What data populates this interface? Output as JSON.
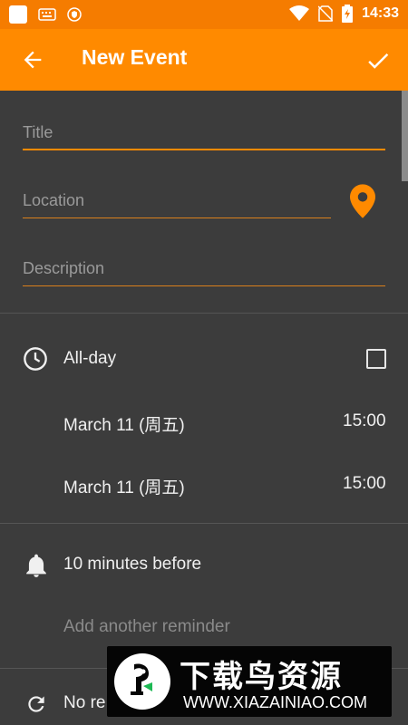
{
  "status_bar": {
    "time": "14:33",
    "icons": [
      "app-square-icon",
      "keyboard-icon",
      "shield-icon",
      "wifi-icon",
      "no-sim-icon",
      "battery-charging-icon"
    ]
  },
  "app_bar": {
    "title": "New Event",
    "back_icon": "arrow-left-icon",
    "save_icon": "check-icon"
  },
  "form": {
    "title_placeholder": "Title",
    "location_placeholder": "Location",
    "description_placeholder": "Description"
  },
  "all_day": {
    "label": "All-day",
    "checked": false
  },
  "start": {
    "date": "March 11 (周五)",
    "time": "15:00"
  },
  "end": {
    "date": "March 11 (周五)",
    "time": "15:00"
  },
  "reminders": {
    "first": "10 minutes before",
    "add": "Add another reminder"
  },
  "repeat": {
    "label_visible": "No re"
  },
  "watermark": {
    "chinese": "下载鸟资源",
    "url": "WWW.XIAZAINIAO.COM"
  },
  "colors": {
    "accent": "#ff8a00",
    "status_bar": "#f57c00",
    "background": "#3c3c3c"
  }
}
